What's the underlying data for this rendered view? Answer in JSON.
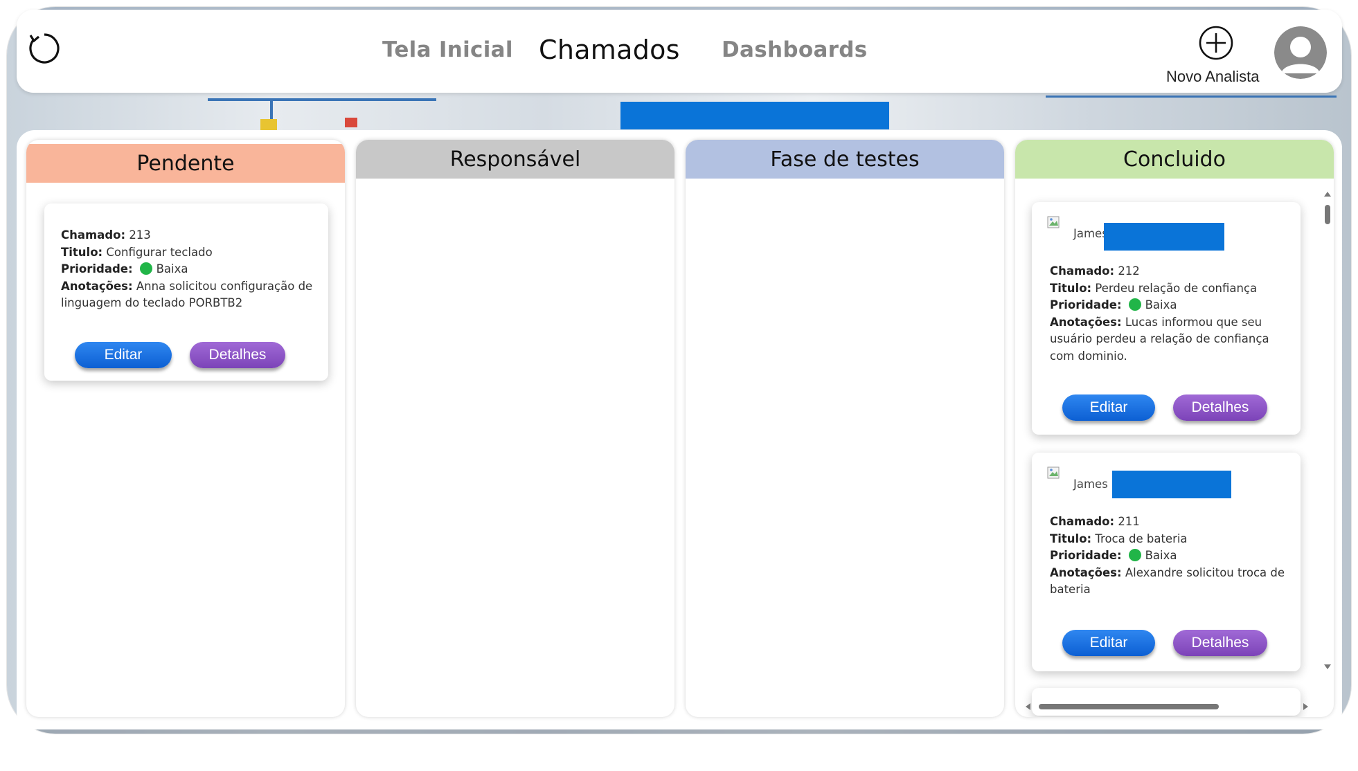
{
  "header": {
    "refresh_icon": "refresh-icon",
    "nav": {
      "home": "Tela Inicial",
      "tickets": "Chamados",
      "dashboards": "Dashboards"
    },
    "new_analyst_label": "Novo Analista",
    "add_icon": "plus-circle-icon",
    "avatar_icon": "user-avatar-icon"
  },
  "colors": {
    "accent": "#0a74d8",
    "pending": "#f9b59a",
    "responsible": "#c8c8c8",
    "testing": "#b2c1e1",
    "done": "#c8e6ab",
    "priority_low": "#21b548",
    "edit_button": "#1a6fe0",
    "details_button": "#8d55c8"
  },
  "columns": {
    "pending": {
      "title": "Pendente",
      "cards": [
        {
          "ticket_label": "Chamado:",
          "ticket": "213",
          "title_label": "Titulo:",
          "title": "Configurar teclado",
          "priority_label": "Prioridade:",
          "priority": "Baixa",
          "notes_label": "Anotações:",
          "notes": "Anna solicitou configuração de linguagem do teclado PORBTB2",
          "edit": "Editar",
          "details": "Detalhes"
        }
      ]
    },
    "responsible": {
      "title": "Responsável"
    },
    "testing": {
      "title": "Fase de testes"
    },
    "done": {
      "title": "Concluido",
      "cards": [
        {
          "user": "James",
          "ticket_label": "Chamado:",
          "ticket": "212",
          "title_label": "Titulo:",
          "title": "Perdeu relação de confiança",
          "priority_label": "Prioridade:",
          "priority": "Baixa",
          "notes_label": "Anotações:",
          "notes": "Lucas informou que seu usuário perdeu a relação de confiança com dominio.",
          "edit": "Editar",
          "details": "Detalhes"
        },
        {
          "user": "James",
          "ticket_label": "Chamado:",
          "ticket": "211",
          "title_label": "Titulo:",
          "title": "Troca de bateria",
          "priority_label": "Prioridade:",
          "priority": "Baixa",
          "notes_label": "Anotações:",
          "notes": "Alexandre solicitou troca de bateria",
          "edit": "Editar",
          "details": "Detalhes"
        }
      ]
    }
  }
}
